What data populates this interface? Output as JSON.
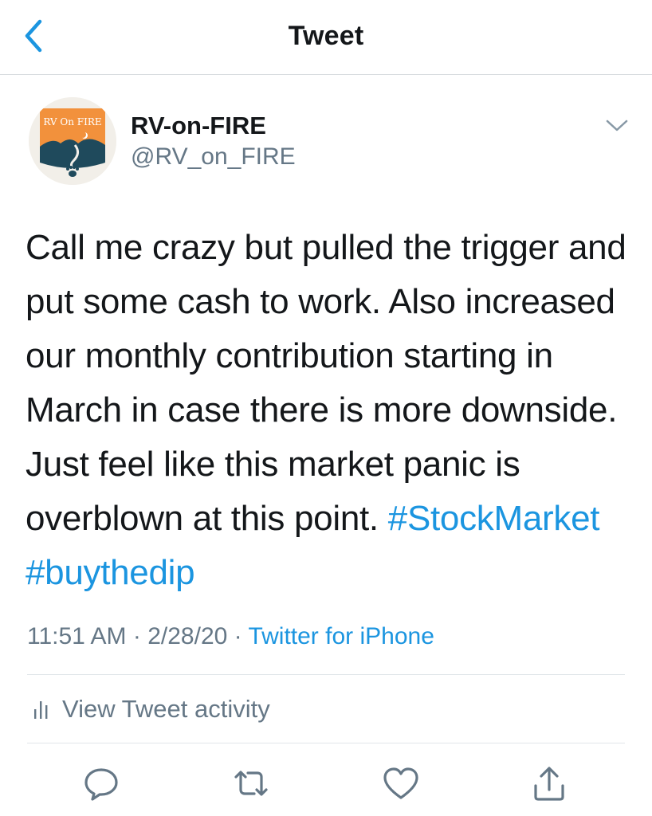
{
  "header": {
    "title": "Tweet",
    "back_icon": "chevron-left-icon",
    "accent_color": "#1b95e0"
  },
  "author": {
    "name": "RV-on-FIRE",
    "handle": "@RV_on_FIRE",
    "avatar_text": "RV On FIRE"
  },
  "tweet": {
    "text": "Call me crazy but pulled the trigger and put some cash to work. Also increased our monthly contribution starting in March in case there is more downside. Just feel like this market panic is overblown at this point.",
    "hashtags": [
      "#StockMarket",
      "#buythedip"
    ],
    "time": "11:51 AM",
    "date": "2/28/20",
    "separator": "·",
    "source": "Twitter for iPhone"
  },
  "activity": {
    "label": "View Tweet activity",
    "icon": "bar-chart-icon"
  },
  "actions": {
    "reply_icon": "reply-icon",
    "retweet_icon": "retweet-icon",
    "like_icon": "heart-icon",
    "share_icon": "share-icon"
  },
  "colors": {
    "text": "#14171a",
    "secondary": "#657786",
    "link": "#1b95e0",
    "divider": "#e1e6ea"
  }
}
